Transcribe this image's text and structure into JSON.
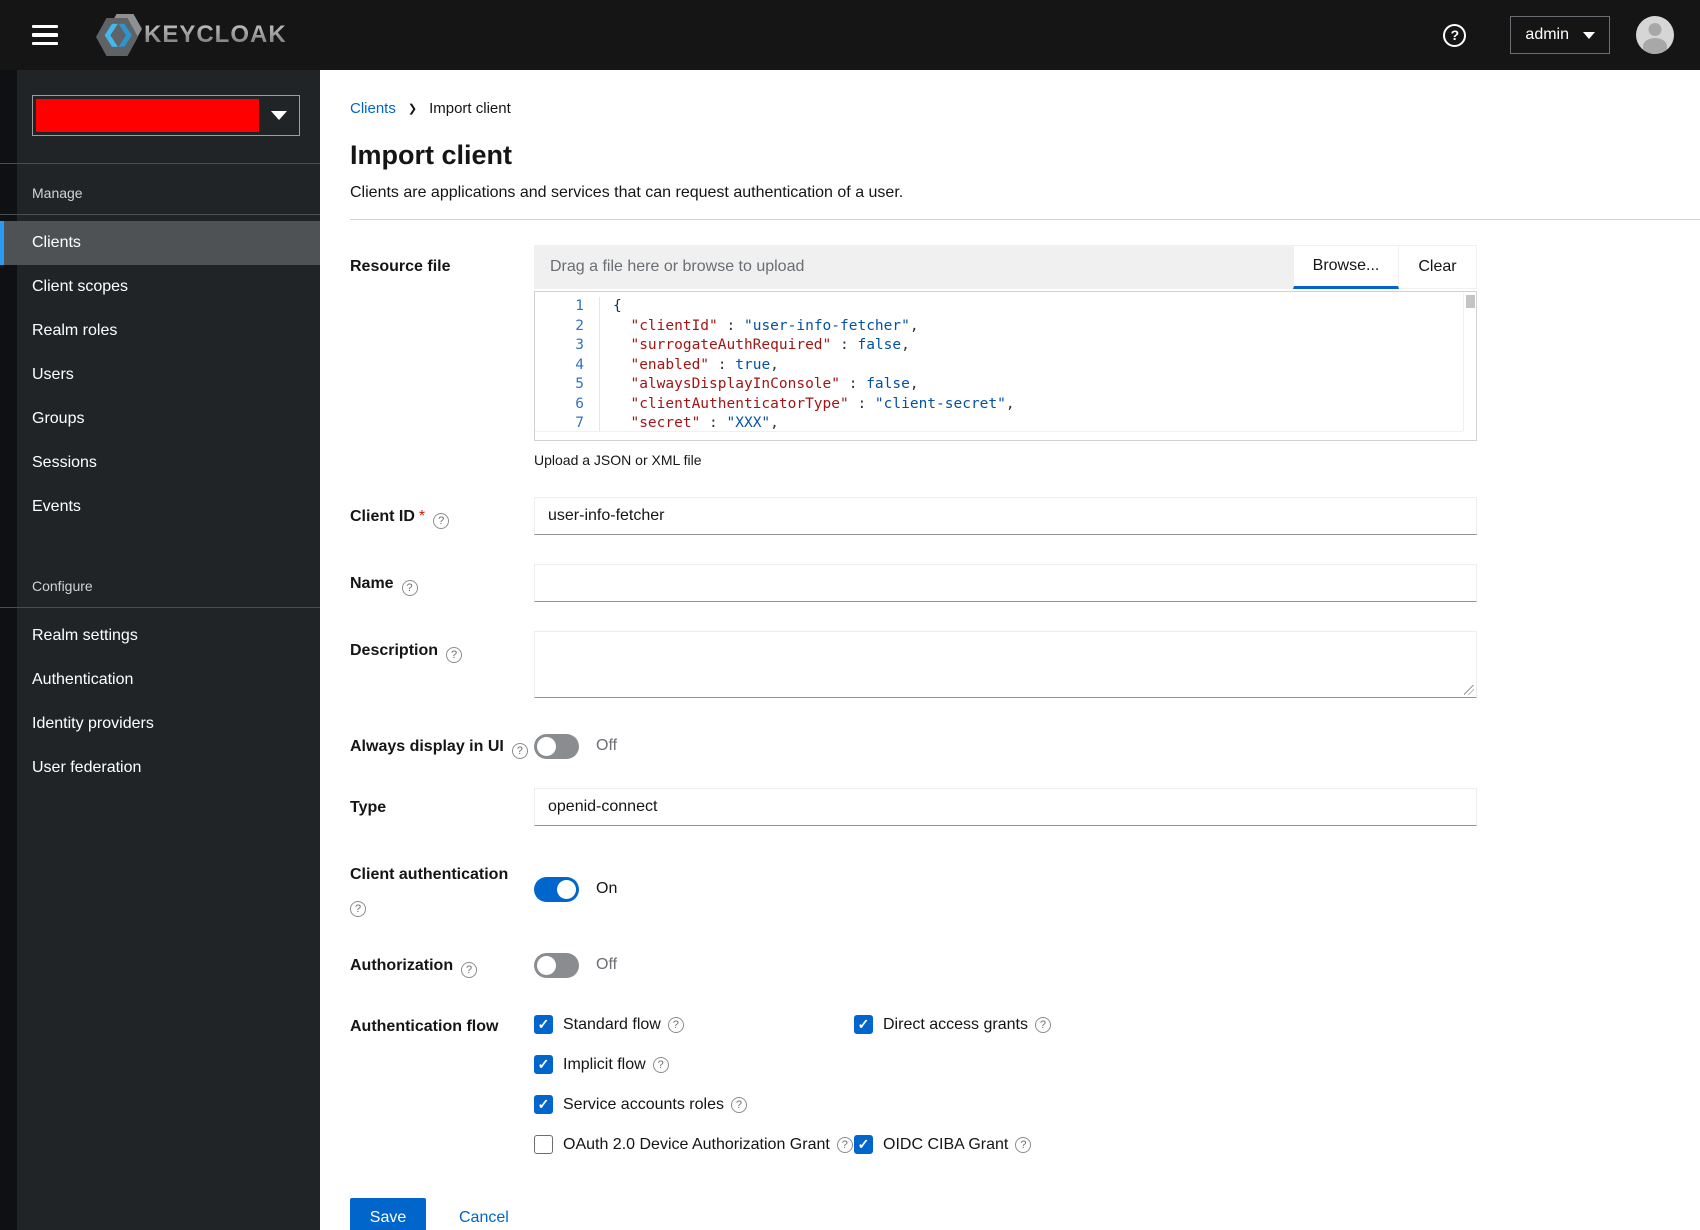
{
  "topbar": {
    "brand": "KEYCLOAK",
    "user_menu_label": "admin"
  },
  "sidebar": {
    "realm_selector_redacted_color": "#ff0000",
    "entries": [
      {
        "kind": "header",
        "label": "Manage"
      },
      {
        "kind": "item",
        "label": "Clients",
        "active": true
      },
      {
        "kind": "item",
        "label": "Client scopes",
        "active": false
      },
      {
        "kind": "item",
        "label": "Realm roles",
        "active": false
      },
      {
        "kind": "item",
        "label": "Users",
        "active": false
      },
      {
        "kind": "item",
        "label": "Groups",
        "active": false
      },
      {
        "kind": "item",
        "label": "Sessions",
        "active": false
      },
      {
        "kind": "item",
        "label": "Events",
        "active": false
      },
      {
        "kind": "spacer",
        "label": ""
      },
      {
        "kind": "header",
        "label": "Configure"
      },
      {
        "kind": "item",
        "label": "Realm settings",
        "active": false
      },
      {
        "kind": "item",
        "label": "Authentication",
        "active": false
      },
      {
        "kind": "item",
        "label": "Identity providers",
        "active": false
      },
      {
        "kind": "item",
        "label": "User federation",
        "active": false
      }
    ]
  },
  "breadcrumb": {
    "parent": "Clients",
    "current": "Import client"
  },
  "header": {
    "title": "Import client",
    "subtitle": "Clients are applications and services that can request authentication of a user."
  },
  "form": {
    "resource_file": {
      "label": "Resource file",
      "placeholder": "Drag a file here or browse to upload",
      "browse_label": "Browse...",
      "clear_label": "Clear",
      "helper_text": "Upload a JSON or XML file",
      "code_lines": [
        {
          "num": "1",
          "tokens": [
            {
              "t": "{",
              "y": "brace"
            }
          ]
        },
        {
          "num": "2",
          "tokens": [
            {
              "t": "  ",
              "y": "plain"
            },
            {
              "t": "\"clientId\"",
              "y": "key"
            },
            {
              "t": " : ",
              "y": "plain"
            },
            {
              "t": "\"user-info-fetcher\"",
              "y": "string"
            },
            {
              "t": ",",
              "y": "plain"
            }
          ]
        },
        {
          "num": "3",
          "tokens": [
            {
              "t": "  ",
              "y": "plain"
            },
            {
              "t": "\"surrogateAuthRequired\"",
              "y": "key"
            },
            {
              "t": " : ",
              "y": "plain"
            },
            {
              "t": "false",
              "y": "atom"
            },
            {
              "t": ",",
              "y": "plain"
            }
          ]
        },
        {
          "num": "4",
          "tokens": [
            {
              "t": "  ",
              "y": "plain"
            },
            {
              "t": "\"enabled\"",
              "y": "key"
            },
            {
              "t": " : ",
              "y": "plain"
            },
            {
              "t": "true",
              "y": "atom"
            },
            {
              "t": ",",
              "y": "plain"
            }
          ]
        },
        {
          "num": "5",
          "tokens": [
            {
              "t": "  ",
              "y": "plain"
            },
            {
              "t": "\"alwaysDisplayInConsole\"",
              "y": "key"
            },
            {
              "t": " : ",
              "y": "plain"
            },
            {
              "t": "false",
              "y": "atom"
            },
            {
              "t": ",",
              "y": "plain"
            }
          ]
        },
        {
          "num": "6",
          "tokens": [
            {
              "t": "  ",
              "y": "plain"
            },
            {
              "t": "\"clientAuthenticatorType\"",
              "y": "key"
            },
            {
              "t": " : ",
              "y": "plain"
            },
            {
              "t": "\"client-secret\"",
              "y": "string"
            },
            {
              "t": ",",
              "y": "plain"
            }
          ]
        },
        {
          "num": "7",
          "tokens": [
            {
              "t": "  ",
              "y": "plain"
            },
            {
              "t": "\"secret\"",
              "y": "key"
            },
            {
              "t": " : ",
              "y": "plain"
            },
            {
              "t": "\"XXX\"",
              "y": "string"
            },
            {
              "t": ",",
              "y": "plain"
            }
          ]
        }
      ]
    },
    "client_id": {
      "label": "Client ID",
      "required": "*",
      "value": "user-info-fetcher"
    },
    "name": {
      "label": "Name",
      "value": ""
    },
    "description": {
      "label": "Description",
      "value": ""
    },
    "always_display": {
      "label": "Always display in UI",
      "state": "Off"
    },
    "type": {
      "label": "Type",
      "value": "openid-connect"
    },
    "client_auth": {
      "label": "Client authentication",
      "state": "On"
    },
    "authorization": {
      "label": "Authorization",
      "state": "Off"
    },
    "auth_flow": {
      "label": "Authentication flow",
      "checkboxes": [
        {
          "label": "Standard flow",
          "checked": true
        },
        {
          "label": "Direct access grants",
          "checked": true
        },
        {
          "label": "Implicit flow",
          "checked": true
        },
        {
          "label": "Service accounts roles",
          "checked": true
        },
        {
          "label": "OAuth 2.0 Device Authorization Grant",
          "checked": false
        },
        {
          "label": "OIDC CIBA Grant",
          "checked": true
        }
      ]
    },
    "actions": {
      "save": "Save",
      "cancel": "Cancel"
    }
  },
  "colors": {
    "accent_blue": "#0066cc",
    "topbar_bg": "#151515",
    "sidebar_bg": "#212427",
    "nav_active_border": "#2b9af3",
    "realm_redacted": "#ff0000",
    "code_key": "#a31515",
    "code_string": "#0451a5",
    "code_line_number": "#3173c4",
    "required_asterisk": "#c9190b"
  }
}
